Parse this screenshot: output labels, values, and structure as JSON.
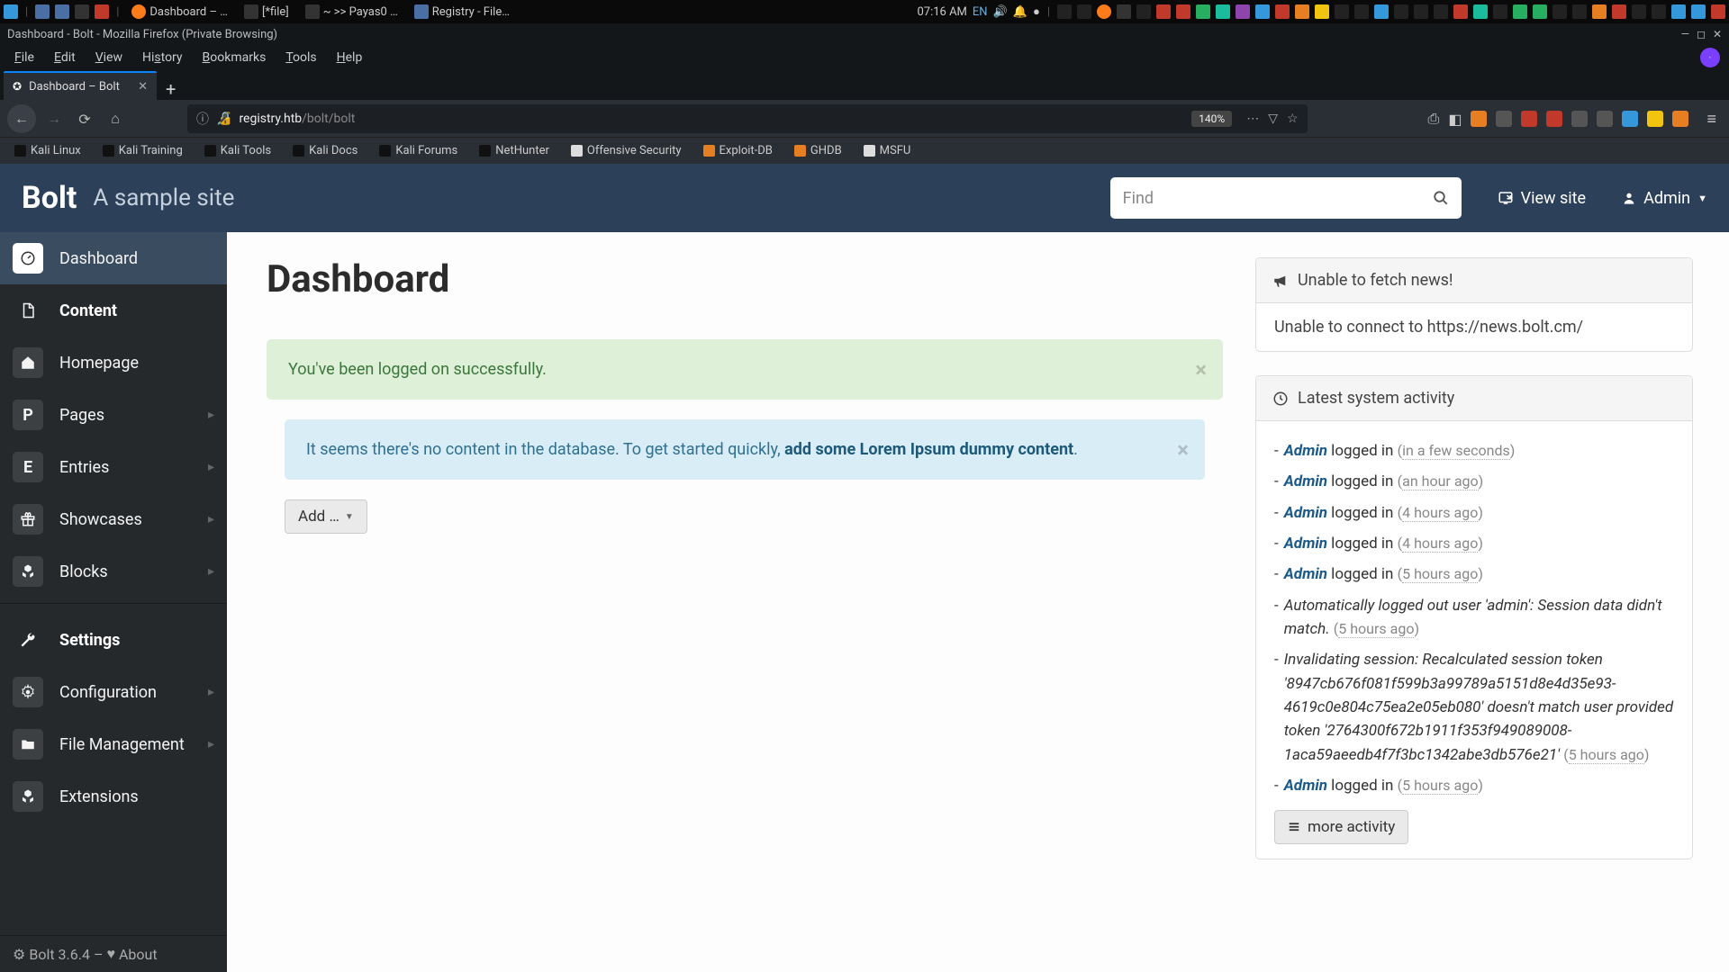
{
  "sys": {
    "tasks": [
      {
        "icon": "ff",
        "label": "Dashboard – …"
      },
      {
        "icon": "term",
        "label": "[*file]"
      },
      {
        "icon": "term",
        "label": "~ >> Payas0 …"
      },
      {
        "icon": "folder",
        "label": "Registry - File…"
      }
    ],
    "clock": "07:16 AM",
    "lang": "EN"
  },
  "firefox": {
    "title": "Dashboard - Bolt - Mozilla Firefox (Private Browsing)",
    "menu": [
      "File",
      "Edit",
      "View",
      "History",
      "Bookmarks",
      "Tools",
      "Help"
    ],
    "tab": "Dashboard – Bolt",
    "url_host": "registry.htb",
    "url_path": "/bolt/bolt",
    "zoom": "140%",
    "bookmarks": [
      "Kali Linux",
      "Kali Training",
      "Kali Tools",
      "Kali Docs",
      "Kali Forums",
      "NetHunter",
      "Offensive Security",
      "Exploit-DB",
      "GHDB",
      "MSFU"
    ]
  },
  "bolt": {
    "brand": "Bolt",
    "tagline": "A sample site",
    "search_placeholder": "Find",
    "view_site": "View site",
    "admin": "Admin",
    "sidebar": {
      "dashboard": "Dashboard",
      "content": "Content",
      "homepage": "Homepage",
      "pages": "Pages",
      "entries": "Entries",
      "showcases": "Showcases",
      "blocks": "Blocks",
      "settings": "Settings",
      "configuration": "Configuration",
      "file_management": "File Management",
      "extensions": "Extensions"
    },
    "footer": {
      "version": "Bolt 3.6.4",
      "sep": " – ",
      "about": "About"
    },
    "page_title": "Dashboard",
    "alert_success": "You've been logged on successfully.",
    "alert_info_prefix": "It seems there's no content in the database. To get started quickly, ",
    "alert_info_link": "add some Lorem Ipsum dummy content",
    "alert_info_suffix": ".",
    "add_button": "Add …",
    "news": {
      "title": "Unable to fetch news!",
      "body": "Unable to connect to https://news.bolt.cm/"
    },
    "activity": {
      "title": "Latest system activity",
      "items": [
        {
          "type": "login",
          "user": "Admin",
          "action": " logged in ",
          "time": "in a few seconds"
        },
        {
          "type": "login",
          "user": "Admin",
          "action": " logged in ",
          "time": "an hour ago"
        },
        {
          "type": "login",
          "user": "Admin",
          "action": " logged in ",
          "time": "4 hours ago"
        },
        {
          "type": "login",
          "user": "Admin",
          "action": " logged in ",
          "time": "4 hours ago"
        },
        {
          "type": "login",
          "user": "Admin",
          "action": " logged in ",
          "time": "5 hours ago"
        },
        {
          "type": "sys",
          "msg": "Automatically logged out user 'admin': Session data didn't match.",
          "time": "5 hours ago"
        },
        {
          "type": "sys",
          "msg": "Invalidating session: Recalculated session token '8947cb676f081f599b3a99789a5151d8e4d35e93-4619c0e804c75ea2e05eb080' doesn't match user provided token '2764300f672b1911f353f949089008-1aca59aeedb4f7f3bc1342abe3db576e21'",
          "time": "5 hours ago"
        },
        {
          "type": "login",
          "user": "Admin",
          "action": " logged in ",
          "time": "5 hours ago"
        }
      ],
      "more": "more activity"
    }
  }
}
